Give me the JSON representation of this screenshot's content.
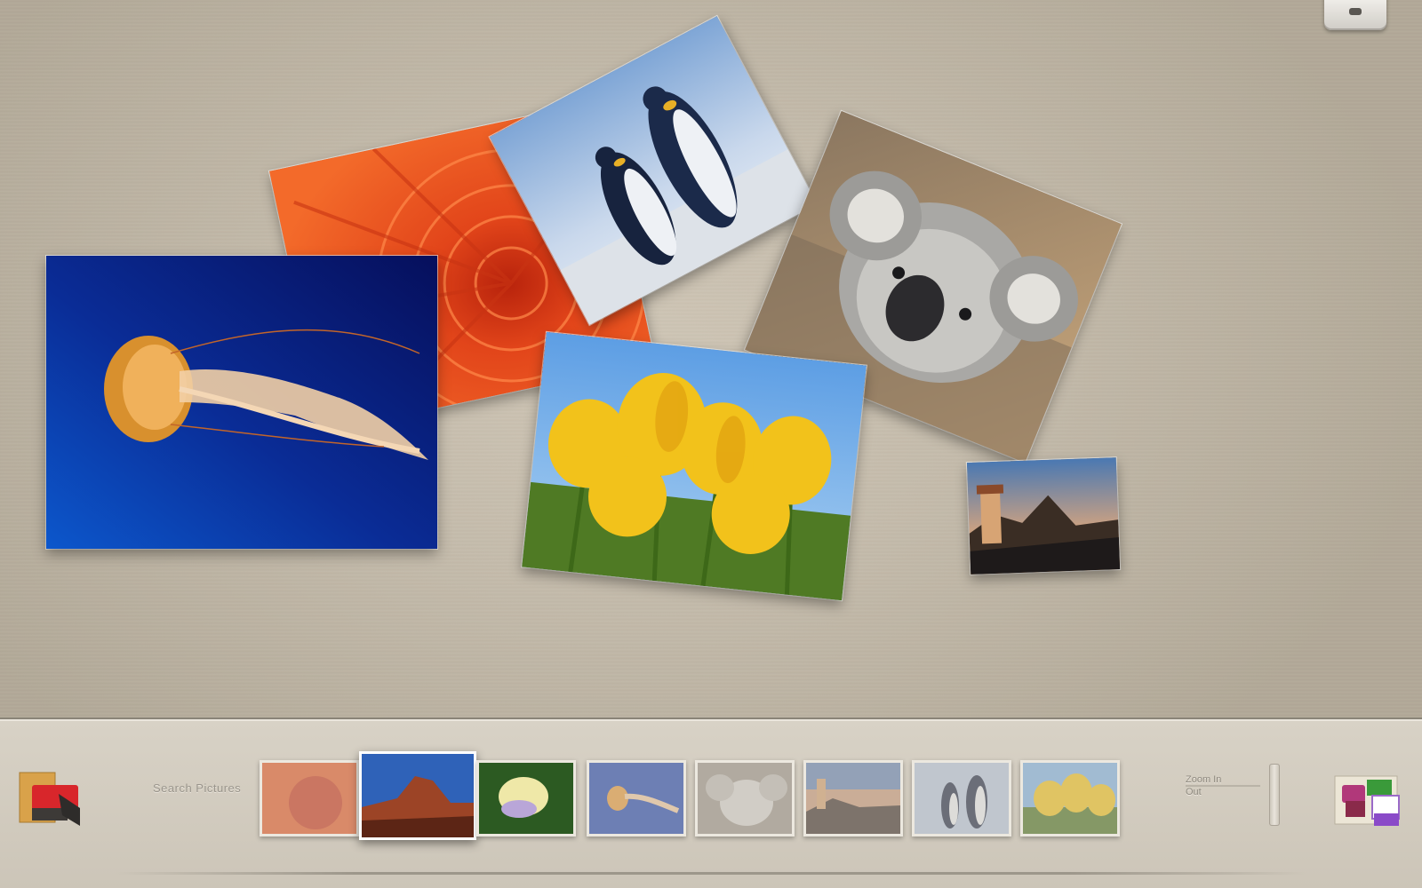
{
  "window": {
    "top_button_icon": "eject-icon"
  },
  "board": {
    "photos": [
      {
        "name": "jellyfish",
        "icon": "jellyfish-photo"
      },
      {
        "name": "chrysanthemum",
        "icon": "flower-photo"
      },
      {
        "name": "penguins",
        "icon": "penguins-photo"
      },
      {
        "name": "koala",
        "icon": "koala-photo"
      },
      {
        "name": "tulips",
        "icon": "tulips-photo"
      },
      {
        "name": "lighthouse",
        "icon": "lighthouse-photo"
      }
    ]
  },
  "tray": {
    "album_icon": "photo-album-icon",
    "label": "Search Pictures",
    "zoom_label_top": "Zoom In",
    "zoom_label_bottom": "Out",
    "collage_icon": "collage-icon",
    "thumbnails": [
      {
        "name": "chrysanthemum",
        "selected": false
      },
      {
        "name": "desert",
        "selected": true
      },
      {
        "name": "hydrangeas",
        "selected": false
      },
      {
        "name": "jellyfish",
        "selected": false
      },
      {
        "name": "koala",
        "selected": false
      },
      {
        "name": "lighthouse",
        "selected": false
      },
      {
        "name": "penguins",
        "selected": false
      },
      {
        "name": "tulips",
        "selected": false
      }
    ]
  },
  "colors": {
    "board_background": "#c8bfb0",
    "tray_background": "#d4cdc1",
    "thumb_border": "#ece8df"
  }
}
